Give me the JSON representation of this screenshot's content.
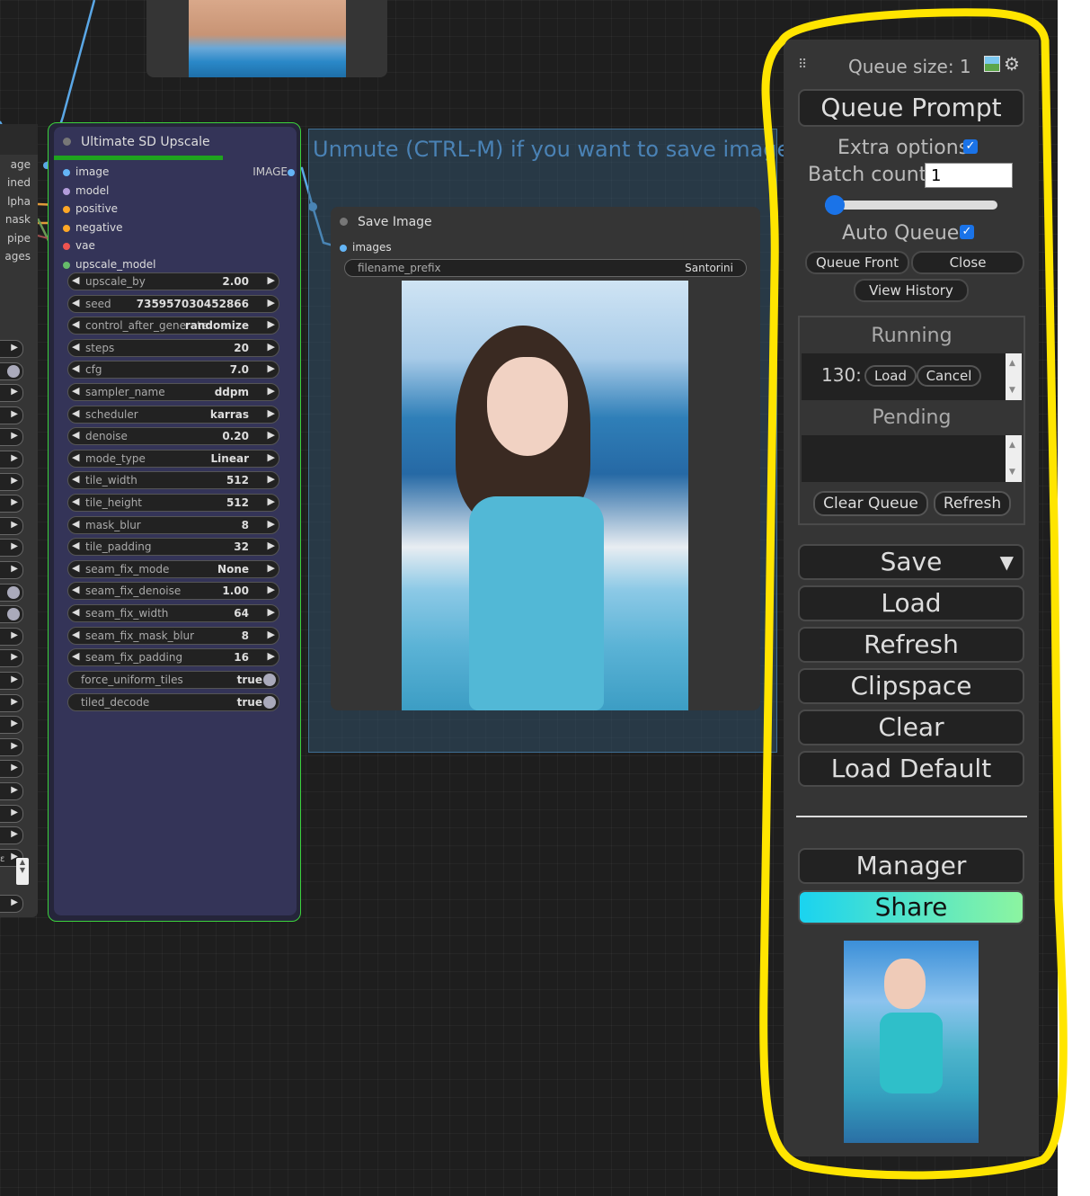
{
  "left_node": {
    "labels": [
      "age",
      "ined",
      "lpha",
      "nask",
      "pipe",
      "ages"
    ],
    "scroll_text": "ε"
  },
  "ultimate_node": {
    "title": "Ultimate SD Upscale",
    "inputs": [
      {
        "name": "image",
        "color": "#64b5f6"
      },
      {
        "name": "model",
        "color": "#b39ddb"
      },
      {
        "name": "positive",
        "color": "#ffa726"
      },
      {
        "name": "negative",
        "color": "#ffa726"
      },
      {
        "name": "vae",
        "color": "#ef5350"
      },
      {
        "name": "upscale_model",
        "color": "#66bb6a"
      }
    ],
    "output": "IMAGE",
    "widgets": [
      {
        "name": "upscale_by",
        "value": "2.00"
      },
      {
        "name": "seed",
        "value": "735957030452866"
      },
      {
        "name": "control_after_generate",
        "value": "randomize"
      },
      {
        "name": "steps",
        "value": "20"
      },
      {
        "name": "cfg",
        "value": "7.0"
      },
      {
        "name": "sampler_name",
        "value": "ddpm"
      },
      {
        "name": "scheduler",
        "value": "karras"
      },
      {
        "name": "denoise",
        "value": "0.20"
      },
      {
        "name": "mode_type",
        "value": "Linear"
      },
      {
        "name": "tile_width",
        "value": "512"
      },
      {
        "name": "tile_height",
        "value": "512"
      },
      {
        "name": "mask_blur",
        "value": "8"
      },
      {
        "name": "tile_padding",
        "value": "32"
      },
      {
        "name": "seam_fix_mode",
        "value": "None"
      },
      {
        "name": "seam_fix_denoise",
        "value": "1.00"
      },
      {
        "name": "seam_fix_width",
        "value": "64"
      },
      {
        "name": "seam_fix_mask_blur",
        "value": "8"
      },
      {
        "name": "seam_fix_padding",
        "value": "16"
      }
    ],
    "toggles": [
      {
        "name": "force_uniform_tiles",
        "value": "true"
      },
      {
        "name": "tiled_decode",
        "value": "true"
      }
    ]
  },
  "group": {
    "title": "Unmute (CTRL-M) if you want to save images."
  },
  "save_node": {
    "title": "Save Image",
    "input": "images",
    "filename_prefix_label": "filename_prefix",
    "filename_prefix_value": "Santorini"
  },
  "panel": {
    "drag_handle": "⠿",
    "queue_size": "Queue size: 1",
    "queue_prompt": "Queue Prompt",
    "extra_options": "Extra options",
    "batch_count_label": "Batch count",
    "batch_count_value": "1",
    "auto_queue": "Auto Queue",
    "queue_front": "Queue Front",
    "close": "Close",
    "view_history": "View History",
    "running": "Running",
    "running_item": "130:",
    "load_small": "Load",
    "cancel": "Cancel",
    "pending": "Pending",
    "clear_queue": "Clear Queue",
    "refresh_small": "Refresh",
    "save": "Save",
    "save_caret": "▼",
    "load": "Load",
    "refresh": "Refresh",
    "clipspace": "Clipspace",
    "clear": "Clear",
    "load_default": "Load Default",
    "manager": "Manager",
    "share": "Share"
  },
  "colors": {
    "highlight": "#ffe500",
    "node_border": "#3cd33c",
    "accent": "#1a73e8"
  }
}
